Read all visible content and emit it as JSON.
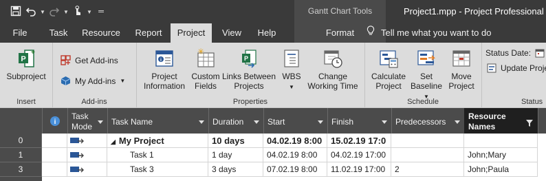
{
  "quick_access": {
    "save_icon": "save-icon",
    "undo_icon": "undo-icon",
    "redo_icon": "redo-icon",
    "touch_icon": "touch-mode-icon",
    "customize_icon": "customize-qat-icon"
  },
  "titlebar": {
    "contextual_tools": "Gantt Chart Tools",
    "document_title": "Project1.mpp  -  Project Professional"
  },
  "tabs": {
    "file": "File",
    "task": "Task",
    "resource": "Resource",
    "report": "Report",
    "project": "Project",
    "view": "View",
    "help": "Help",
    "format": "Format",
    "active": "Project"
  },
  "tell_me": "Tell me what you want to do",
  "ribbon": {
    "insert": {
      "label": "Insert",
      "subproject": "Subproject"
    },
    "addins": {
      "label": "Add-ins",
      "get_addins": "Get Add-ins",
      "my_addins": "My Add-ins"
    },
    "properties": {
      "label": "Properties",
      "project_information": [
        "Project",
        "Information"
      ],
      "custom_fields": [
        "Custom",
        "Fields"
      ],
      "links_between_projects": [
        "Links Between",
        "Projects"
      ],
      "wbs": "WBS",
      "change_working_time": [
        "Change",
        "Working Time"
      ]
    },
    "schedule": {
      "label": "Schedule",
      "calculate_project": [
        "Calculate",
        "Project"
      ],
      "set_baseline": [
        "Set",
        "Baseline"
      ],
      "move_project": [
        "Move",
        "Project"
      ]
    },
    "status": {
      "label": "Status",
      "status_date": "Status Date:",
      "update_project": "Update Projec"
    }
  },
  "grid": {
    "columns": {
      "task_mode": [
        "Task",
        "Mode"
      ],
      "task_name": "Task Name",
      "duration": "Duration",
      "start": "Start",
      "finish": "Finish",
      "predecessors": "Predecessors",
      "resource_names": [
        "Resource",
        "Names"
      ]
    },
    "rows": [
      {
        "id": "0",
        "name": "My Project",
        "duration": "10 days",
        "start": "04.02.19 8:00",
        "finish": "15.02.19 17:0",
        "predecessors": "",
        "resources": "",
        "summary": true
      },
      {
        "id": "1",
        "name": "Task 1",
        "duration": "1 day",
        "start": "04.02.19 8:00",
        "finish": "04.02.19 17:00",
        "predecessors": "",
        "resources": "John;Mary",
        "summary": false
      },
      {
        "id": "3",
        "name": "Task 3",
        "duration": "3 days",
        "start": "07.02.19 8:00",
        "finish": "11.02.19 17:00",
        "predecessors": "2",
        "resources": "John;Paula",
        "summary": false
      }
    ]
  },
  "colors": {
    "titlebar": "#3a3a3a",
    "ribbon": "#dcdcdc",
    "header": "#4b4b4b",
    "project_green": "#217346"
  }
}
